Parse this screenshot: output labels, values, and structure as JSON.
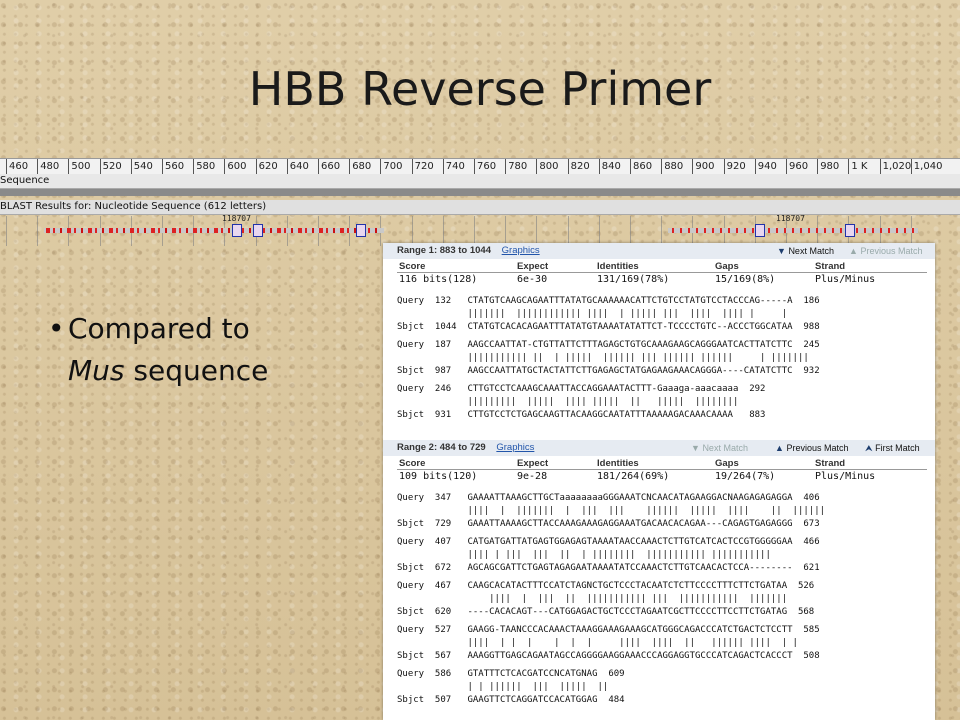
{
  "slide": {
    "title": "HBB Reverse Primer",
    "bullet_prefix": "Compared to",
    "bullet_italic": "Mus",
    "bullet_suffix": " sequence"
  },
  "viewer": {
    "ruler_ticks": [
      "460",
      "480",
      "500",
      "520",
      "540",
      "560",
      "580",
      "600",
      "620",
      "640",
      "660",
      "680",
      "700",
      "720",
      "740",
      "760",
      "780",
      "800",
      "820",
      "840",
      "860",
      "880",
      "900",
      "920",
      "940",
      "960",
      "980",
      "1 K",
      "1,020",
      "1,040"
    ],
    "sequence_label": "Sequence",
    "blast_label": "BLAST Results for: Nucleotide Sequence (612 letters)",
    "marker_left": "118707",
    "marker_right": "118707"
  },
  "range1": {
    "title": "Range 1: 883 to 1044",
    "graphics": "Graphics",
    "next": "Next Match",
    "prev": "Previous Match",
    "score_label": "Score",
    "score": "116 bits(128)",
    "expect_label": "Expect",
    "expect": "6e-30",
    "ident_label": "Identities",
    "ident": "131/169(78%)",
    "gaps_label": "Gaps",
    "gaps": "15/169(8%)",
    "strand_label": "Strand",
    "strand": "Plus/Minus",
    "lines": [
      "Query  132   CTATGTCAAGCAGAATTTATATGCAAAAAACATTCTGTCCTATGTCCTACCCAG-----A  186",
      "             |||||||  |||||||||||| ||||  | ||||| |||  ||||  |||| |     |",
      "Sbjct  1044  CTATGTCACACAGAATTTATATGTAAAATATATTCT-TCCCCTGTC--ACCCTGGCATAA  988",
      "",
      "Query  187   AAGCCAATTAT-CTGTTATTCTTTAGAGCTGTGCAAAGAAGCAGGGAATCACTTATCTTC  245",
      "             ||||||||||| ||  | |||||  |||||| ||| |||||| ||||||     | |||||||",
      "Sbjct  987   AAGCCAATTATGCTACTATTCTTGAGAGCTATGAGAAGAAACAGGGA----CATATCTTC  932",
      "",
      "Query  246   CTTGTCCTCAAAGCAAATTACCAGGAAATACTTT-Gaaaga-aaacaaaa  292",
      "             |||||||||  |||||  |||| |||||  ||   |||||  ||||||||",
      "Sbjct  931   CTTGTCCTCTGAGCAAGTTACAAGGCAATATTTAAAAAGACAAACAAAA   883"
    ]
  },
  "range2": {
    "title": "Range 2: 484 to 729",
    "graphics": "Graphics",
    "next": "Next Match",
    "prev": "Previous Match",
    "first": "First Match",
    "score_label": "Score",
    "score": "109 bits(120)",
    "expect_label": "Expect",
    "expect": "9e-28",
    "ident_label": "Identities",
    "ident": "181/264(69%)",
    "gaps_label": "Gaps",
    "gaps": "19/264(7%)",
    "strand_label": "Strand",
    "strand": "Plus/Minus",
    "lines": [
      "Query  347   GAAAATTAAAGCTTGCTaaaaaaaaGGGAAATCNCAACATAGAAGGACNAAGAGAGAGGA  406",
      "             ||||  |  |||||||  |  |||  |||    ||||||  |||||  ||||    ||  ||||||",
      "Sbjct  729   GAAATTAAAAGCTTACCAAAGAAAGAGGAAATGACAACACAGAA---CAGAGTGAGAGGG  673",
      "",
      "Query  407   CATGATGATTATGAGTGGAGAGTAAAATAACCAAACTCTTGTCATCACTCCGTGGGGGAA  466",
      "             |||| | |||  |||  ||  | ||||||||  ||||||||||| |||||||||||",
      "Sbjct  672   AGCAGCGATTCTGAGTAGAGAATAAAATATCCAAACTCTTGTCAACACTCCA--------  621",
      "",
      "Query  467   CAAGCACATACTTTCCATCTAGNCTGCTCCCTACAATCTCTTCCCCTTTCTTCTGATAA  526",
      "                 ||||  |  |||  ||  ||||||||||| |||  |||||||||||  |||||||",
      "Sbjct  620   ----CACACAGT---CATGGAGACTGCTCCCTAGAATCGCTTCCCCTTCCTTCTGATAG  568",
      "",
      "Query  527   GAAGG-TAANCCCACAAACTAAAGGAAAGAAAGCATGGGCAGACCCATCTGACTCTCCTT  585",
      "             ||||  | |  |    |  |  |     ||||  ||||  ||   |||||| ||||  | |",
      "Sbjct  567   AAAGGTTGAGCAGAATAGCCAGGGGAAGGAAACCCAGGAGGTGCCCATCAGACTCACCCT  508",
      "",
      "Query  586   GTATTTCTCACGATCCNCATGNAG  609",
      "             | | ||||||  |||  |||||  ||",
      "Sbjct  507   GAAGTTCTCAGGATCCACATGGAG  484"
    ]
  }
}
